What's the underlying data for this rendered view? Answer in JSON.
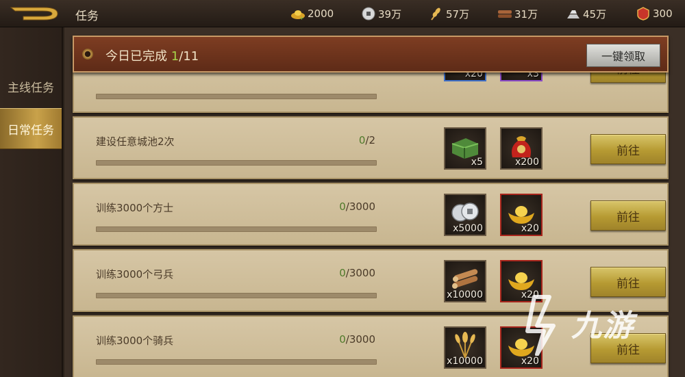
{
  "topbar": {
    "title": "任务",
    "resources": [
      {
        "icon": "gold-ingot-icon",
        "value": "2000"
      },
      {
        "icon": "coin-icon",
        "value": "39万"
      },
      {
        "icon": "grain-icon",
        "value": "57万"
      },
      {
        "icon": "wood-icon",
        "value": "31万"
      },
      {
        "icon": "iron-icon",
        "value": "45万"
      },
      {
        "icon": "badge-icon",
        "value": "300"
      }
    ]
  },
  "nav": {
    "items": [
      {
        "label": "主线任务",
        "active": false
      },
      {
        "label": "日常任务",
        "active": true
      }
    ]
  },
  "banner": {
    "prefix": "今日已完成 ",
    "completed": "1",
    "total": "/11",
    "claim_all_label": "一键领取"
  },
  "tasks": [
    {
      "name": "",
      "done": "",
      "target": "",
      "progress": 0,
      "rewards": [
        {
          "icon": "scroll-blue-icon",
          "count": "x20",
          "rarity": "blue"
        },
        {
          "icon": "horn-icon",
          "count": "x3",
          "rarity": "purple"
        }
      ],
      "go_label": "前往"
    },
    {
      "name": "建设任意城池2次",
      "done": "0",
      "target": "/2",
      "progress": 0,
      "rewards": [
        {
          "icon": "green-gift-box-icon",
          "count": "x5",
          "rarity": "normal"
        },
        {
          "icon": "red-pouch-icon",
          "count": "x200",
          "rarity": "normal"
        }
      ],
      "go_label": "前往"
    },
    {
      "name": "训练3000个方士",
      "done": "0",
      "target": "/3000",
      "progress": 0,
      "rewards": [
        {
          "icon": "silver-coins-icon",
          "count": "x5000",
          "rarity": "normal"
        },
        {
          "icon": "gold-ingot-icon",
          "count": "x20",
          "rarity": "red"
        }
      ],
      "go_label": "前往"
    },
    {
      "name": "训练3000个弓兵",
      "done": "0",
      "target": "/3000",
      "progress": 0,
      "rewards": [
        {
          "icon": "wood-logs-icon",
          "count": "x10000",
          "rarity": "normal"
        },
        {
          "icon": "gold-ingot-icon",
          "count": "x20",
          "rarity": "red"
        }
      ],
      "go_label": "前往"
    },
    {
      "name": "训练3000个骑兵",
      "done": "0",
      "target": "/3000",
      "progress": 0,
      "rewards": [
        {
          "icon": "wheat-icon",
          "count": "x10000",
          "rarity": "normal"
        },
        {
          "icon": "gold-ingot-icon",
          "count": "x20",
          "rarity": "red"
        }
      ],
      "go_label": "前往"
    }
  ],
  "watermark": {
    "text": "九游"
  }
}
